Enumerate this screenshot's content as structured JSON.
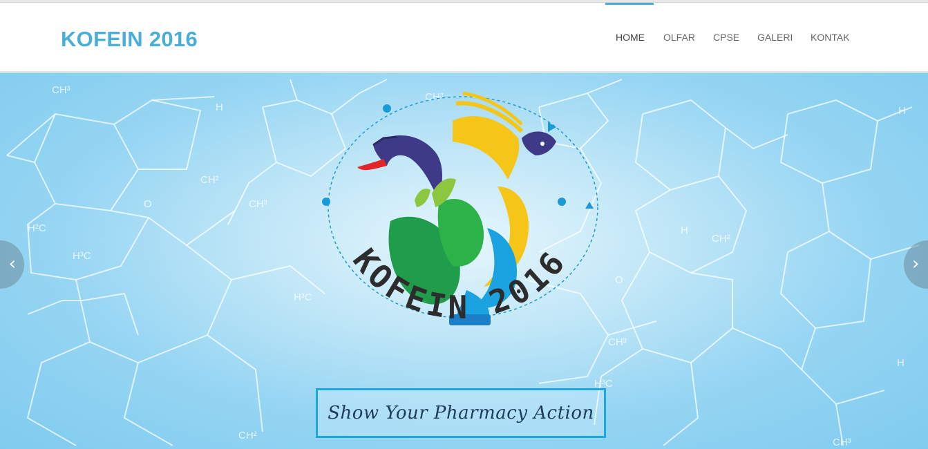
{
  "header": {
    "brand": "KOFEIN 2016",
    "nav": [
      {
        "label": "HOME",
        "active": true
      },
      {
        "label": "OLFAR",
        "active": false
      },
      {
        "label": "CPSE",
        "active": false
      },
      {
        "label": "GALERI",
        "active": false
      },
      {
        "label": "KONTAK",
        "active": false
      }
    ]
  },
  "hero": {
    "logo_text": "KOFEIN 2016",
    "tagline": "Show Your Pharmacy Action",
    "prev_icon": "chevron-left-icon",
    "next_icon": "chevron-right-icon",
    "background_labels": [
      "CH³",
      "CH²",
      "H",
      "H³C",
      "H²C",
      "O",
      "CH³",
      "H³C",
      "CH³",
      "H³C",
      "H",
      "CH²",
      "O",
      "CH³",
      "H",
      "O",
      "CH²",
      "H"
    ]
  },
  "colors": {
    "accent": "#4aaed6",
    "tagline_border": "#1fa6dc",
    "logo_text": "#2c2c2c"
  }
}
